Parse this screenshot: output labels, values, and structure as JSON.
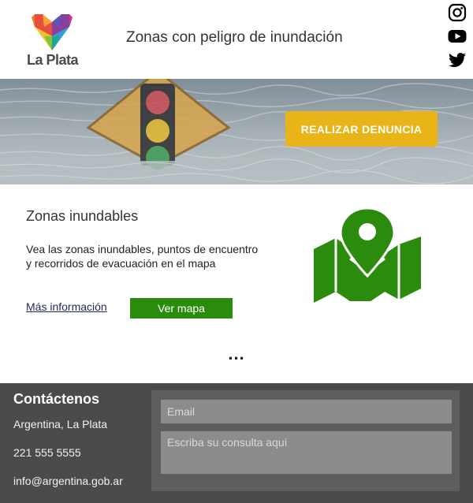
{
  "header": {
    "logo_text": "La Plata",
    "title": "Zonas con peligro de inundación",
    "social": [
      {
        "icon": "instagram-icon"
      },
      {
        "icon": "youtube-icon"
      },
      {
        "icon": "twitter-icon"
      }
    ]
  },
  "hero": {
    "cta_label": "REALIZAR DENUNCIA"
  },
  "zones": {
    "title": "Zonas inundables",
    "description": "Vea las zonas inundables, puntos de encuentro y recorridos de evacuación en el mapa",
    "more_info": "Más información",
    "map_button": "Ver mapa",
    "icon": "map-pin-icon"
  },
  "ellipsis": "...",
  "footer": {
    "title": "Contáctenos",
    "location": "Argentina, La Plata",
    "phone": "221 555 5555",
    "email": "info@argentina.gob.ar",
    "email_placeholder": "Email",
    "message_placeholder": "Escriba su consulta aquí"
  },
  "colors": {
    "accent_yellow": "#e8b418",
    "accent_green": "#2a8b0c",
    "footer_bg": "#4b4b4b",
    "link_blue": "#1f2a55"
  }
}
